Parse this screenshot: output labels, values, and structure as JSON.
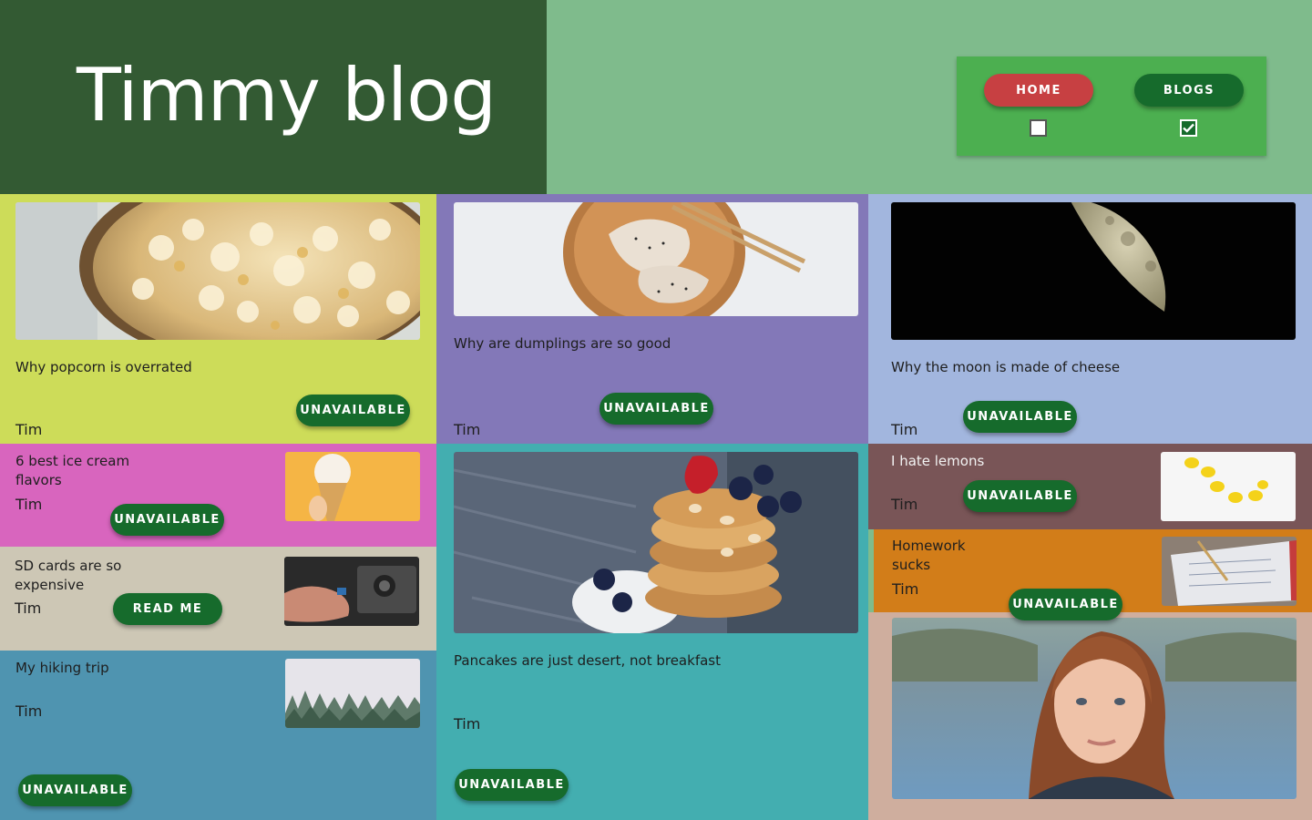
{
  "header": {
    "title": "Timmy blog"
  },
  "nav": {
    "home_label": "HOME",
    "blogs_label": "BLOGS",
    "home_checked": false,
    "blogs_checked": true
  },
  "posts": [
    {
      "title": "Why popcorn is overrated",
      "author": "Tim",
      "button": "UNAVAILABLE",
      "bg": "#cddc59",
      "image": "popcorn"
    },
    {
      "title": "Why are dumplings are so good",
      "author": "Tim",
      "button": "UNAVAILABLE",
      "bg": "#8378b8",
      "image": "dumplings"
    },
    {
      "title": "Why the moon is made of cheese",
      "author": "Tim",
      "button": "UNAVAILABLE",
      "bg": "#a2b6de",
      "image": "moon"
    },
    {
      "title": "6 best ice cream flavors",
      "author": "Tim",
      "button": "UNAVAILABLE",
      "bg": "#d865be",
      "image": "ice-cream"
    },
    {
      "title": "Pancakes are just desert, not breakfast",
      "author": "Tim",
      "button": "UNAVAILABLE",
      "bg": "#43aeb0",
      "image": "pancakes"
    },
    {
      "title": "I hate lemons",
      "author": "Tim",
      "button": "UNAVAILABLE",
      "bg": "#795557",
      "image": "lemons"
    },
    {
      "title": "SD cards are so expensive",
      "author": "Tim",
      "button": "READ ME",
      "bg": "#cdc7b5",
      "image": "camera"
    },
    {
      "title": "Homework sucks",
      "author": "Tim",
      "button": "UNAVAILABLE",
      "bg": "#d27d19",
      "image": "notebook"
    },
    {
      "title": "My hiking trip",
      "author": "Tim",
      "button": "UNAVAILABLE",
      "bg": "#4f94b0",
      "image": "forest"
    },
    {
      "title": "",
      "author": "",
      "button": "",
      "bg": "#cfae9e",
      "image": "portrait"
    }
  ],
  "colors": {
    "accent": "#166b2c",
    "home_button": "#c74042",
    "header_dark": "#335a33",
    "header_light": "#7fbb8c",
    "nav_panel": "#4caf50"
  }
}
